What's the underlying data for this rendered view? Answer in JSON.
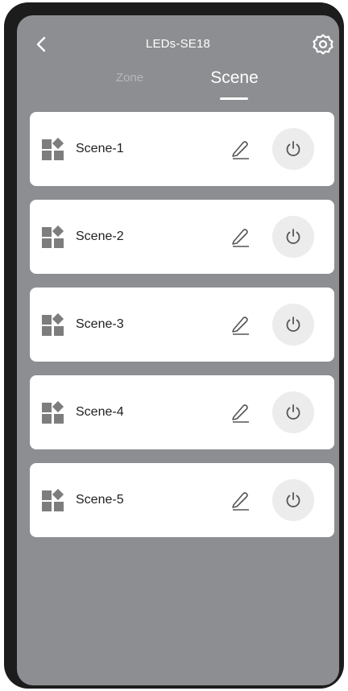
{
  "header": {
    "title": "LEDs-SE18",
    "back_icon": "chevron-left-icon",
    "settings_icon": "gear-icon"
  },
  "tabs": [
    {
      "label": "Zone",
      "active": false
    },
    {
      "label": "Scene",
      "active": true
    }
  ],
  "scenes": [
    {
      "label": "Scene-1"
    },
    {
      "label": "Scene-2"
    },
    {
      "label": "Scene-3"
    },
    {
      "label": "Scene-4"
    },
    {
      "label": "Scene-5"
    }
  ],
  "icons": {
    "scene": "scene-grid-icon",
    "edit": "pencil-icon",
    "power": "power-icon"
  },
  "colors": {
    "screen_background": "#8d8e91",
    "card_background": "#ffffff",
    "power_button_background": "#ececec",
    "icon_gray": "#7d7d7d"
  }
}
